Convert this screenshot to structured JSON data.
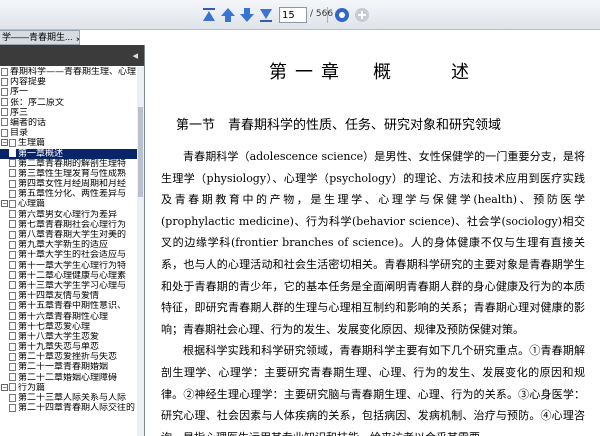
{
  "toolbar": {
    "page_current": "15",
    "page_total": "/ 566"
  },
  "panel_tab": {
    "label": "学——青春期生...",
    "close": "×"
  },
  "sidebar": {
    "collapse_arrow": "◂",
    "items": [
      {
        "label": "春期科学——青春期生理、心理",
        "level": 0,
        "toggle": ""
      },
      {
        "label": "内容提要",
        "level": 0,
        "toggle": ""
      },
      {
        "label": "序一",
        "level": 0,
        "toggle": ""
      },
      {
        "label": "张：序二原文",
        "level": 0,
        "toggle": ""
      },
      {
        "label": "序三",
        "level": 0,
        "toggle": ""
      },
      {
        "label": "编者的话",
        "level": 0,
        "toggle": ""
      },
      {
        "label": "目录",
        "level": 0,
        "toggle": ""
      },
      {
        "label": "生理篇",
        "level": 0,
        "toggle": "−"
      },
      {
        "label": "第一章概述",
        "level": 1,
        "toggle": "",
        "selected": true
      },
      {
        "label": "第二章青春期的解剖生理特",
        "level": 1,
        "toggle": ""
      },
      {
        "label": "第三章性生理发育与性成熟",
        "level": 1,
        "toggle": ""
      },
      {
        "label": "第四章女性月经周期和月经",
        "level": 1,
        "toggle": ""
      },
      {
        "label": "第五章性分化、两性差异与",
        "level": 1,
        "toggle": ""
      },
      {
        "label": "心理篇",
        "level": 0,
        "toggle": "−"
      },
      {
        "label": "第六章男女心理行为差异",
        "level": 1,
        "toggle": ""
      },
      {
        "label": "第七章青春期社会心理行为",
        "level": 1,
        "toggle": ""
      },
      {
        "label": "第八章青春期大学生对美的",
        "level": 1,
        "toggle": ""
      },
      {
        "label": "第九章大学新生的适应",
        "level": 1,
        "toggle": ""
      },
      {
        "label": "第十章大学生的社会适应与",
        "level": 1,
        "toggle": ""
      },
      {
        "label": "第十一章大学生心理行为特",
        "level": 1,
        "toggle": ""
      },
      {
        "label": "第十二章心理健康与心理素",
        "level": 1,
        "toggle": ""
      },
      {
        "label": "第十三章大学生学习心理与",
        "level": 1,
        "toggle": ""
      },
      {
        "label": "第十四章友情与爱情",
        "level": 1,
        "toggle": ""
      },
      {
        "label": "第十五章青春中期性意识、",
        "level": 1,
        "toggle": ""
      },
      {
        "label": "第十六章青春期性心理",
        "level": 1,
        "toggle": ""
      },
      {
        "label": "第十七章恋爱心理",
        "level": 1,
        "toggle": ""
      },
      {
        "label": "第十八章大学生恋爱",
        "level": 1,
        "toggle": ""
      },
      {
        "label": "第十九章失恋与单恋",
        "level": 1,
        "toggle": ""
      },
      {
        "label": "第二十章恋爱挫折与失恋",
        "level": 1,
        "toggle": ""
      },
      {
        "label": "第二十一章青春期婚姻",
        "level": 1,
        "toggle": ""
      },
      {
        "label": "第二十二章婚姻心理障碍",
        "level": 1,
        "toggle": ""
      },
      {
        "label": "行为篇",
        "level": 0,
        "toggle": "−"
      },
      {
        "label": "第二十三章人际关系与人际",
        "level": 1,
        "toggle": ""
      },
      {
        "label": "第二十四章青春期人际交往的",
        "level": 1,
        "toggle": ""
      }
    ]
  },
  "doc": {
    "chapter_title": "第一章　概　　述",
    "section_title": "第一节　青春期科学的性质、任务、研究对象和研究领域",
    "paragraphs": [
      "青春期科学（adolescence science）是男性、女性保健学的一门重要分支，是将生理学（physiology）、心理学（psychology）的理论、方法和技术应用到医疗实践及青春期教育中的产物，是生理学、心理学与保健学(health)、预防医学(prophylactic medicine)、行为科学(behavior science)、社会学(sociology)相交叉的边缘学科(frontier branches of science)。人的身体健康不仅与生理有直接关系，也与人的心理活动和社会生活密切相关。青春期科学研究的主要对象是青春期学生和处于青春期的青少年，它的基本任务是全面阐明青春期人群的身心健康及行为的本质特征，即研究青春期人群的生理与心理相互制约和影响的关系；青春期心理对健康的影响；青春期社会心理、行为的发生、发展变化原因、规律及预防保健对策。",
      "根据科学实践和科学研究领域，青春期科学主要有如下几个研究重点。①青春期解剖生理学、心理学：主要研究青春期生理、心理、行为的发生、发展变化的原因和规律。②神经生理心理学：主要研究脑与青春期生理、心理、行为的关系。③心身医学：研究心理、社会因素与人体疾病的关系，包括病因、发病机制、治疗与预防。④心理咨询，是指心理医生运用其专业知识和技能，给来访者以合乎其需要"
    ]
  }
}
